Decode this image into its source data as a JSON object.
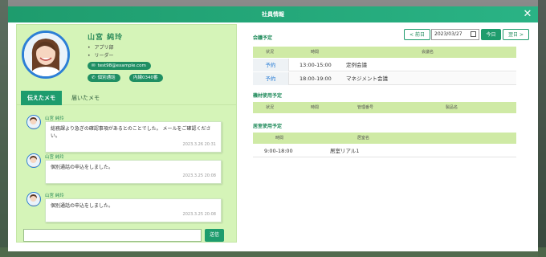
{
  "modal": {
    "title": "社員情報",
    "close_glyph": "✕"
  },
  "profile": {
    "name": "山宮 純玲",
    "bullets": [
      "アプリ部",
      "リーダー"
    ],
    "email": "test98@example.com",
    "direct_call": "個別通話",
    "extension": "内線0340番"
  },
  "memo_tabs": {
    "tab1": "伝えたメモ",
    "tab2": "届いたメモ"
  },
  "memos": [
    {
      "author": "山宮 純玲",
      "text": "総務課より急ぎの確認事項があるとのことでした。 メールをご確認ください。",
      "timestamp": "2023.3.26 20:31"
    },
    {
      "author": "山宮 純玲",
      "text": "個別通話の申込をしました。",
      "timestamp": "2023.3.25 20:08"
    },
    {
      "author": "山宮 純玲",
      "text": "個別通話の申込をしました。",
      "timestamp": "2023.3.25 20:08"
    }
  ],
  "memo_input": {
    "placeholder": ""
  },
  "send_label": "送信",
  "meetings": {
    "title": "会議予定",
    "headers": [
      "状況",
      "時間",
      "会議名"
    ],
    "rows": [
      {
        "status": "予約",
        "time": "13:00-15:00",
        "name": "定例会議"
      },
      {
        "status": "予約",
        "time": "18:00-19:00",
        "name": "マネジメント会議"
      }
    ]
  },
  "nav": {
    "prev": "< 前日",
    "date": "2023/03/27",
    "today": "今日",
    "next": "翌日 >"
  },
  "equipment": {
    "title": "機材使用予定",
    "headers": [
      "状況",
      "時間",
      "管理番号",
      "製品名"
    ]
  },
  "rooms": {
    "title": "居室使用予定",
    "headers": [
      "時間",
      "居室名"
    ],
    "rows": [
      {
        "time": "9:00-18:00",
        "name": "居室リアル1"
      }
    ]
  },
  "colors": {
    "accent": "#1e9c6d",
    "panel": "#d5f4b8",
    "table_head": "#cfeaa5",
    "link": "#2c7fd6"
  },
  "icons": [
    "close-icon",
    "mail-icon",
    "phone-icon",
    "calendar-icon",
    "avatar-photo"
  ]
}
